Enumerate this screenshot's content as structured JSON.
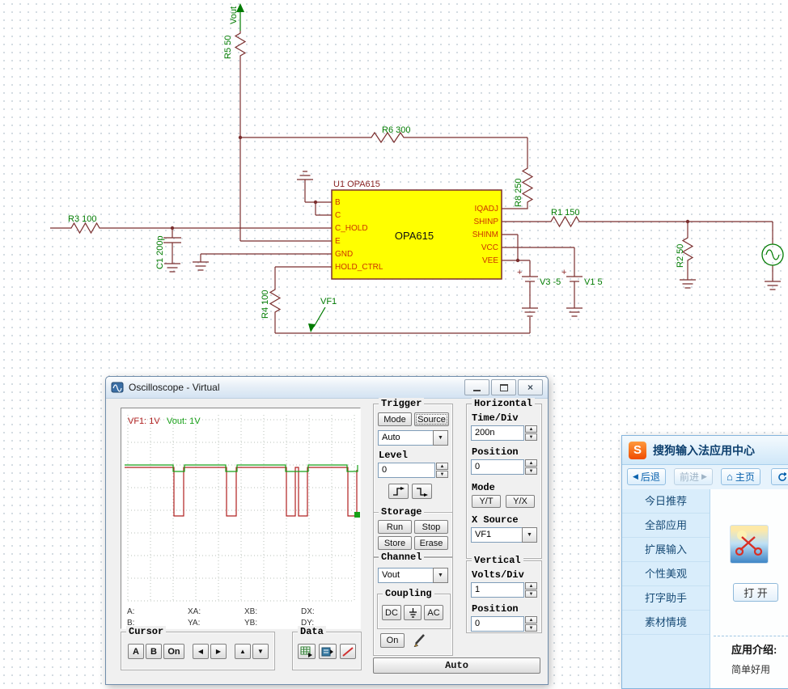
{
  "schematic": {
    "net_labels": {
      "vout": "Vout",
      "vf1": "VF1"
    },
    "components": {
      "r1": "R1 150",
      "r2": "R2 50",
      "r3": "R3 100",
      "r4": "R4 100",
      "r5": "R5 50",
      "r6": "R6 300",
      "r8": "R8 250",
      "c1": "C1 200p",
      "v3": "V3 -5",
      "v1": "V1 5",
      "plus": "+"
    },
    "chip": {
      "ref": "U1 OPA615",
      "name": "OPA615",
      "left_pins": [
        "B",
        "C",
        "C_HOLD",
        "E",
        "GND",
        "HOLD_CTRL"
      ],
      "right_pins": [
        "IQADJ",
        "SHINP",
        "SHINM",
        "VCC",
        "VEE"
      ]
    }
  },
  "oscilloscope": {
    "title": "Oscilloscope - Virtual",
    "trace_labels": {
      "ch1": "VF1: 1V",
      "ch2": "Vout: 1V"
    },
    "readouts": {
      "row1": [
        "A:",
        "XA:",
        "XB:",
        "DX:"
      ],
      "row2": [
        "B:",
        "YA:",
        "YB:",
        "DY:"
      ]
    },
    "trigger": {
      "title": "Trigger",
      "mode": "Mode",
      "source": "Source",
      "mode_value": "Auto",
      "level_label": "Level",
      "level_value": "0"
    },
    "horizontal": {
      "title": "Horizontal",
      "time_div_label": "Time/Div",
      "time_div_value": "200n",
      "position_label": "Position",
      "position_value": "0",
      "mode_label": "Mode",
      "yt": "Y/T",
      "yx": "Y/X",
      "x_source_label": "X Source",
      "x_source_value": "VF1"
    },
    "storage": {
      "title": "Storage",
      "run": "Run",
      "stop": "Stop",
      "store": "Store",
      "erase": "Erase"
    },
    "channel": {
      "title": "Channel",
      "value": "Vout",
      "coupling_label": "Coupling",
      "dc": "DC",
      "ac": "AC",
      "on": "On"
    },
    "vertical": {
      "title": "Vertical",
      "volts_div_label": "Volts/Div",
      "volts_div_value": "1",
      "position_label": "Position",
      "position_value": "0"
    },
    "cursor": {
      "title": "Cursor",
      "a": "A",
      "b": "B",
      "on": "On"
    },
    "data_group": {
      "title": "Data"
    },
    "auto_button": "Auto"
  },
  "sogou": {
    "logo": "S",
    "title": "搜狗输入法应用中心",
    "back": "后退",
    "forward": "前进",
    "home": "主页",
    "menu": [
      "今日推荐",
      "全部应用",
      "扩展输入",
      "个性美观",
      "打字助手",
      "素材情境"
    ],
    "open_button": "打 开",
    "intro_label": "应用介绍:",
    "intro_text": "简单好用"
  },
  "icons": {
    "combo_arrow": "▼",
    "spin_up": "▲",
    "spin_down": "▼",
    "cursor_left": "◀",
    "cursor_right": "▶",
    "cursor_up": "▲",
    "cursor_down": "▼",
    "back_arrow": "◀",
    "forward_arrow": "▶",
    "home": "⌂",
    "close": "×"
  }
}
